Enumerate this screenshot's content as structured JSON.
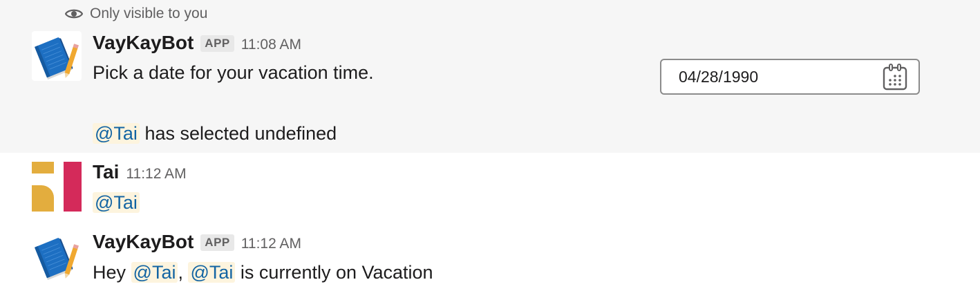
{
  "messages": [
    {
      "ephemeral_label": "Only visible to you",
      "sender": "VayKayBot",
      "badge": "APP",
      "time": "11:08 AM",
      "text": "Pick a date for your vacation time.",
      "datepicker_value": "04/28/1990",
      "followup_mention": "@Tai",
      "followup_text": " has selected undefined",
      "avatar_icon": "notebook-pencil-icon"
    },
    {
      "sender": "Tai",
      "time": "11:12 AM",
      "mention": "@Tai",
      "avatar_icon": "user-avatar-icon"
    },
    {
      "sender": "VayKayBot",
      "badge": "APP",
      "time": "11:12 AM",
      "text_prefix": "Hey ",
      "mention1": "@Tai",
      "separator": ", ",
      "mention2": "@Tai",
      "text_suffix": " is currently on Vacation",
      "avatar_icon": "notebook-pencil-icon"
    }
  ],
  "colors": {
    "mention_text": "#1264a3",
    "mention_bg": "#fdf4de",
    "highlight_bg": "#f6f6f6",
    "avatar_yellow": "#e3ad3e",
    "avatar_red": "#d42a5a",
    "notebook_blue": "#1d6fc2"
  }
}
